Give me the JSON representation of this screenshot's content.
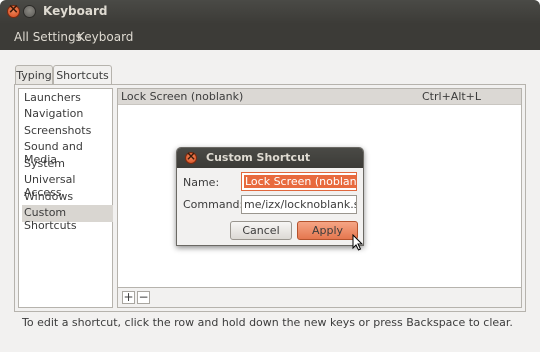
{
  "window": {
    "title": "Keyboard",
    "nav": {
      "all_settings": "All Settings",
      "current": "Keyboard"
    }
  },
  "tabs": [
    {
      "label": "Typing",
      "active": false
    },
    {
      "label": "Shortcuts",
      "active": true
    }
  ],
  "sidebar": {
    "items": [
      {
        "label": "Launchers"
      },
      {
        "label": "Navigation"
      },
      {
        "label": "Screenshots"
      },
      {
        "label": "Sound and Media"
      },
      {
        "label": "System"
      },
      {
        "label": "Universal Access"
      },
      {
        "label": "Windows"
      },
      {
        "label": "Custom Shortcuts",
        "selected": true
      }
    ]
  },
  "shortcut_list": {
    "rows": [
      {
        "name": "Lock Screen (noblank)",
        "accel": "Ctrl+Alt+L"
      }
    ]
  },
  "toolbar": {
    "add_label": "+",
    "remove_label": "−"
  },
  "hint": "To edit a shortcut, click the row and hold down the new keys or press Backspace to clear.",
  "dialog": {
    "title": "Custom Shortcut",
    "name_label": "Name:",
    "name_value": "Lock Screen (noblank)",
    "command_label": "Command:",
    "command_value": "me/izx/locknoblank.sh",
    "cancel_label": "Cancel",
    "apply_label": "Apply"
  },
  "colors": {
    "accent": "#e86a3e",
    "titlebar": "#3c3b37",
    "selection_row": "#dbd8d4"
  }
}
